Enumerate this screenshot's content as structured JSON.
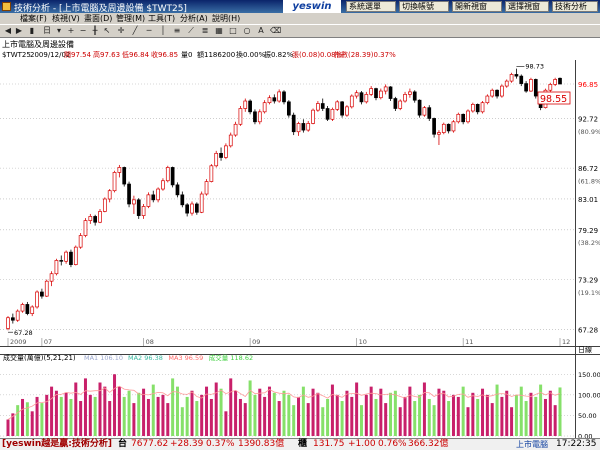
{
  "window": {
    "title": "技術分析 - [上市電腦及周邊設備 $TWT25]"
  },
  "logo": "yeswin",
  "top_buttons": [
    "系統選單",
    "切換帳號",
    "開新視窗",
    "選擇視窗",
    "技術分析"
  ],
  "menu": [
    "檔案(F)",
    "核視(V)",
    "畫面(D)",
    "管理(M)",
    "工具(T)",
    "分析(A)",
    "說明(H)"
  ],
  "toolbar": {
    "period": "日"
  },
  "info": {
    "line1": "上市電腦及周邊設備",
    "symbol": "$TWT25",
    "date": "2009/12/02",
    "open": "開97.54",
    "high": "高97.63",
    "low": "低96.84",
    "close": "收96.85",
    "vol0": "量0",
    "amount": "額1186200",
    "turnover": "換0.00%",
    "amplitude": "振0.82%",
    "change": "張(0.08)0.08%",
    "index_chg": "指數(28.39)0.37%"
  },
  "chart_data": {
    "type": "candlestick",
    "y_axis_labels": [
      {
        "value": 96.85,
        "text": "96.85",
        "color": "#ff0000"
      },
      {
        "value": 92.72,
        "text": "92.72"
      },
      {
        "value": 91.2,
        "text": "(80.9%)"
      },
      {
        "value": 86.72,
        "text": "86.72"
      },
      {
        "value": 85.2,
        "text": "(61.8%)"
      },
      {
        "value": 83.01,
        "text": "83.01"
      },
      {
        "value": 79.29,
        "text": "79.29"
      },
      {
        "value": 77.8,
        "text": "(38.2%)"
      },
      {
        "value": 73.29,
        "text": "73.29"
      },
      {
        "value": 71.8,
        "text": "(19.1%)"
      },
      {
        "value": 67.28,
        "text": "67.28"
      }
    ],
    "y_range": [
      66.5,
      99.5
    ],
    "high_label": "98.73",
    "low_label": "67.28",
    "current_box": "98.55",
    "x_labels": [
      "2009",
      "07",
      "08",
      "09",
      "10",
      "11",
      "12"
    ],
    "x_label_index": [
      0,
      7,
      28,
      50,
      72,
      94,
      114
    ],
    "ohlc": [
      [
        67.4,
        68.9,
        67.2,
        68.7
      ],
      [
        68.7,
        69.2,
        68.0,
        68.4
      ],
      [
        68.4,
        69.7,
        68.2,
        69.5
      ],
      [
        69.5,
        70.5,
        69.3,
        70.3
      ],
      [
        70.3,
        70.6,
        69.0,
        69.2
      ],
      [
        69.2,
        70.2,
        68.9,
        70.0
      ],
      [
        70.0,
        72.0,
        69.8,
        71.8
      ],
      [
        71.8,
        72.2,
        71.0,
        71.3
      ],
      [
        71.3,
        73.3,
        71.2,
        73.1
      ],
      [
        73.1,
        74.3,
        72.5,
        74.0
      ],
      [
        74.0,
        75.8,
        73.8,
        75.6
      ],
      [
        75.6,
        76.2,
        75.0,
        75.5
      ],
      [
        75.5,
        76.8,
        75.2,
        76.6
      ],
      [
        76.6,
        76.9,
        74.8,
        75.1
      ],
      [
        75.1,
        77.4,
        75.0,
        77.2
      ],
      [
        77.2,
        78.9,
        77.0,
        78.6
      ],
      [
        78.6,
        80.7,
        78.4,
        80.4
      ],
      [
        80.4,
        81.2,
        80.0,
        80.9
      ],
      [
        80.9,
        81.1,
        79.8,
        80.2
      ],
      [
        80.2,
        81.8,
        80.1,
        81.5
      ],
      [
        81.5,
        83.2,
        81.4,
        83.0
      ],
      [
        83.0,
        84.2,
        82.6,
        84.0
      ],
      [
        84.0,
        86.4,
        83.8,
        86.2
      ],
      [
        86.2,
        87.1,
        85.6,
        86.8
      ],
      [
        86.8,
        86.9,
        84.5,
        84.8
      ],
      [
        84.8,
        85.1,
        82.0,
        82.4
      ],
      [
        82.4,
        83.4,
        81.2,
        82.9
      ],
      [
        82.9,
        83.1,
        80.6,
        81.0
      ],
      [
        81.0,
        82.4,
        80.6,
        82.1
      ],
      [
        82.1,
        83.8,
        81.9,
        83.5
      ],
      [
        83.5,
        84.0,
        82.6,
        82.9
      ],
      [
        82.9,
        84.4,
        82.6,
        84.2
      ],
      [
        84.2,
        85.5,
        84.0,
        85.2
      ],
      [
        85.2,
        87.0,
        85.0,
        86.8
      ],
      [
        86.8,
        86.9,
        84.4,
        84.7
      ],
      [
        84.7,
        85.0,
        83.2,
        83.5
      ],
      [
        83.5,
        83.9,
        82.0,
        82.3
      ],
      [
        82.3,
        82.5,
        80.9,
        81.3
      ],
      [
        81.3,
        82.7,
        81.0,
        82.4
      ],
      [
        82.4,
        82.6,
        81.1,
        81.4
      ],
      [
        81.4,
        83.9,
        81.3,
        83.6
      ],
      [
        83.6,
        85.4,
        83.4,
        85.1
      ],
      [
        85.1,
        87.2,
        85.0,
        87.0
      ],
      [
        87.0,
        88.8,
        86.8,
        88.5
      ],
      [
        88.5,
        89.2,
        87.6,
        88.0
      ],
      [
        88.0,
        89.7,
        87.8,
        89.4
      ],
      [
        89.4,
        91.0,
        89.2,
        90.7
      ],
      [
        90.7,
        92.3,
        90.5,
        92.0
      ],
      [
        92.0,
        94.2,
        91.8,
        93.9
      ],
      [
        93.9,
        95.1,
        93.5,
        94.8
      ],
      [
        94.8,
        95.0,
        93.2,
        93.5
      ],
      [
        93.5,
        93.8,
        92.0,
        92.3
      ],
      [
        92.3,
        93.8,
        92.0,
        93.5
      ],
      [
        93.5,
        94.9,
        93.3,
        94.6
      ],
      [
        94.6,
        95.5,
        94.4,
        95.2
      ],
      [
        95.2,
        95.6,
        94.5,
        94.8
      ],
      [
        94.8,
        96.2,
        94.6,
        95.9
      ],
      [
        95.9,
        96.1,
        94.4,
        94.7
      ],
      [
        94.7,
        94.9,
        92.8,
        93.1
      ],
      [
        93.1,
        93.4,
        90.7,
        91.1
      ],
      [
        91.1,
        92.3,
        90.6,
        92.1
      ],
      [
        92.1,
        92.6,
        91.0,
        91.3
      ],
      [
        91.3,
        92.4,
        91.1,
        92.1
      ],
      [
        92.1,
        93.9,
        92.0,
        93.7
      ],
      [
        93.7,
        94.8,
        93.5,
        94.5
      ],
      [
        94.5,
        95.1,
        93.6,
        93.9
      ],
      [
        93.9,
        94.2,
        92.4,
        92.6
      ],
      [
        92.6,
        94.0,
        92.4,
        93.8
      ],
      [
        93.8,
        94.9,
        93.6,
        94.7
      ],
      [
        94.7,
        94.8,
        92.8,
        93.1
      ],
      [
        93.1,
        94.3,
        92.9,
        94.1
      ],
      [
        94.1,
        95.6,
        93.9,
        95.4
      ],
      [
        95.4,
        96.1,
        95.1,
        95.8
      ],
      [
        95.8,
        96.0,
        94.4,
        94.7
      ],
      [
        94.7,
        95.9,
        94.5,
        95.6
      ],
      [
        95.6,
        96.6,
        95.4,
        96.3
      ],
      [
        96.3,
        96.4,
        94.9,
        95.2
      ],
      [
        95.2,
        96.3,
        95.0,
        96.0
      ],
      [
        96.0,
        96.8,
        95.6,
        96.5
      ],
      [
        96.5,
        96.6,
        94.8,
        95.1
      ],
      [
        95.1,
        95.3,
        93.6,
        93.9
      ],
      [
        93.9,
        95.0,
        93.7,
        94.8
      ],
      [
        94.8,
        95.9,
        94.6,
        95.6
      ],
      [
        95.6,
        96.3,
        95.2,
        95.9
      ],
      [
        95.9,
        96.1,
        94.6,
        94.9
      ],
      [
        94.9,
        95.0,
        92.8,
        93.1
      ],
      [
        93.1,
        94.2,
        92.9,
        94.0
      ],
      [
        94.0,
        94.3,
        92.4,
        92.7
      ],
      [
        92.7,
        92.8,
        90.4,
        90.8
      ],
      [
        90.8,
        91.3,
        89.5,
        91.0
      ],
      [
        91.0,
        92.2,
        90.8,
        92.0
      ],
      [
        92.0,
        92.1,
        90.9,
        91.2
      ],
      [
        91.2,
        92.5,
        91.0,
        92.3
      ],
      [
        92.3,
        93.4,
        92.1,
        93.2
      ],
      [
        93.2,
        93.3,
        92.0,
        92.3
      ],
      [
        92.3,
        93.8,
        92.1,
        93.6
      ],
      [
        93.6,
        94.6,
        93.4,
        94.4
      ],
      [
        94.4,
        94.5,
        93.2,
        93.5
      ],
      [
        93.5,
        94.8,
        93.3,
        94.6
      ],
      [
        94.6,
        95.6,
        94.4,
        95.4
      ],
      [
        95.4,
        96.3,
        95.2,
        96.1
      ],
      [
        96.1,
        96.2,
        95.1,
        95.4
      ],
      [
        95.4,
        96.8,
        95.2,
        96.6
      ],
      [
        96.6,
        97.4,
        96.4,
        97.2
      ],
      [
        97.2,
        98.2,
        97.0,
        98.0
      ],
      [
        98.0,
        98.7,
        97.5,
        97.8
      ],
      [
        97.8,
        98.0,
        96.6,
        96.9
      ],
      [
        96.9,
        97.2,
        95.8,
        96.0
      ],
      [
        96.0,
        97.6,
        95.9,
        97.4
      ],
      [
        97.4,
        97.5,
        95.1,
        95.4
      ],
      [
        95.4,
        95.6,
        93.7,
        94.0
      ],
      [
        94.0,
        96.3,
        93.9,
        96.1
      ],
      [
        96.1,
        97.0,
        95.9,
        96.8
      ],
      [
        96.8,
        97.6,
        96.6,
        97.4
      ],
      [
        97.54,
        97.63,
        96.84,
        96.85
      ]
    ],
    "volume_title": "成交量(萬億)(5,21,21)",
    "ma_labels": [
      {
        "text": "MA1 106.10",
        "color": "#9aa6cc"
      },
      {
        "text": "MA2 96.38",
        "color": "#3ab8a0"
      },
      {
        "text": "MA3 96.59",
        "color": "#ff6a6a"
      },
      {
        "text": "成交量 118.62",
        "color": "#40d040"
      }
    ],
    "volume_axis": [
      "150.00",
      "100.00",
      "50.00",
      "0.00"
    ],
    "volume_range": [
      0,
      175
    ],
    "volume_unit": "日線",
    "volume": [
      40,
      55,
      75,
      90,
      82,
      60,
      95,
      80,
      100,
      120,
      110,
      95,
      105,
      90,
      130,
      85,
      140,
      100,
      95,
      130,
      120,
      85,
      150,
      120,
      95,
      110,
      80,
      105,
      115,
      90,
      125,
      95,
      100,
      80,
      140,
      120,
      70,
      95,
      110,
      85,
      100,
      120,
      90,
      130,
      115,
      60,
      140,
      110,
      90,
      80,
      135,
      100,
      115,
      95,
      120,
      105,
      85,
      110,
      100,
      75,
      95,
      120,
      80,
      115,
      105,
      70,
      90,
      125,
      100,
      85,
      110,
      95,
      130,
      75,
      100,
      120,
      90,
      115,
      80,
      105,
      110,
      70,
      95,
      120,
      85,
      100,
      130,
      90,
      75,
      115,
      110,
      85,
      100,
      95,
      120,
      70,
      105,
      90,
      115,
      100,
      80,
      125,
      95,
      110,
      70,
      100,
      120,
      85,
      105,
      95,
      125,
      90,
      110,
      75,
      118
    ],
    "volume_color": [
      "r",
      "r",
      "g",
      "r",
      "g",
      "r",
      "r",
      "g",
      "r",
      "r",
      "r",
      "g",
      "r",
      "g",
      "r",
      "r",
      "r",
      "r",
      "g",
      "r",
      "r",
      "r",
      "r",
      "r",
      "g",
      "g",
      "r",
      "g",
      "r",
      "r",
      "g",
      "r",
      "r",
      "r",
      "g",
      "g",
      "g",
      "g",
      "r",
      "g",
      "r",
      "r",
      "r",
      "r",
      "g",
      "r",
      "r",
      "r",
      "r",
      "r",
      "g",
      "g",
      "r",
      "r",
      "r",
      "g",
      "r",
      "g",
      "g",
      "g",
      "r",
      "g",
      "r",
      "r",
      "r",
      "g",
      "g",
      "r",
      "r",
      "g",
      "r",
      "r",
      "r",
      "g",
      "r",
      "r",
      "g",
      "r",
      "r",
      "g",
      "g",
      "r",
      "r",
      "r",
      "g",
      "g",
      "r",
      "g",
      "g",
      "r",
      "r",
      "g",
      "r",
      "r",
      "g",
      "r",
      "r",
      "g",
      "r",
      "r",
      "r",
      "g",
      "r",
      "r",
      "r",
      "g",
      "g",
      "g",
      "r",
      "g",
      "g",
      "r",
      "r",
      "r",
      "g"
    ]
  },
  "status": {
    "brand": "[yeswin越是贏:技術分析]",
    "taiex_label": "台",
    "taiex_price": "7677.62",
    "taiex_chg": "+28.39",
    "taiex_pct": "0.37%",
    "taiex_amt": "1390.83億",
    "otc_label": "櫃",
    "otc_price": "131.75",
    "otc_chg": "+1.00",
    "otc_pct": "0.76%",
    "otc_amt": "366.32億",
    "right_title": "上市電腦",
    "time": "17:22:35"
  }
}
